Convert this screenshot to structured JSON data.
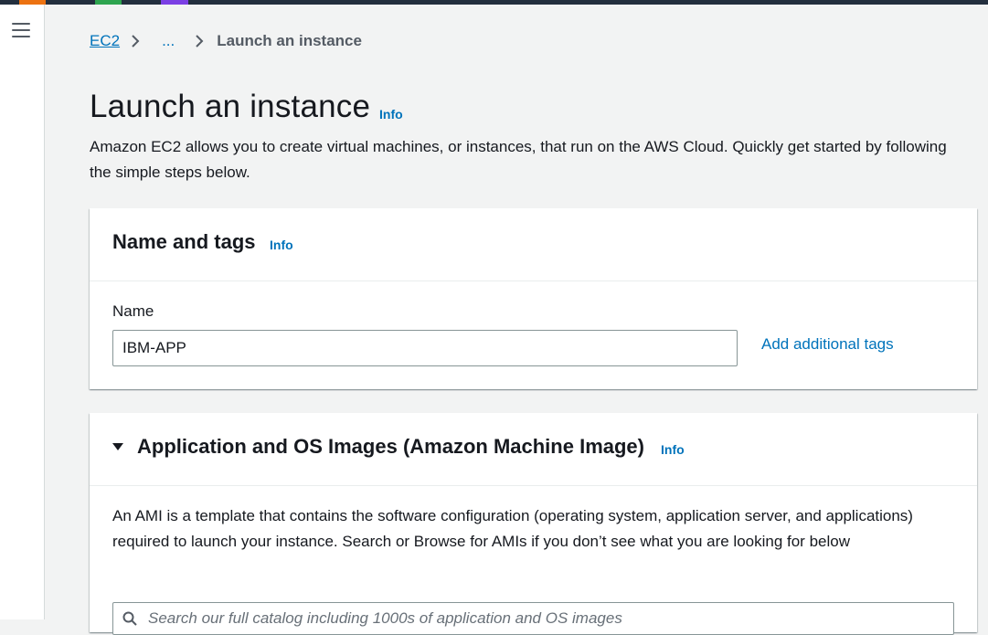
{
  "colors": {
    "topbar": "#232f3e",
    "link": "#0073bb",
    "page_bg": "#f2f3f3",
    "panel_bg": "#ffffff",
    "text": "#16191f"
  },
  "icons": {
    "menu": "hamburger-menu-icon",
    "breadcrumb_separator": "chevron-right-icon",
    "collapse": "caret-down-icon",
    "search": "search-icon"
  },
  "breadcrumb": {
    "root": "EC2",
    "ellipsis": "...",
    "current": "Launch an instance"
  },
  "page": {
    "title": "Launch an instance",
    "info": "Info",
    "description": "Amazon EC2 allows you to create virtual machines, or instances, that run on the AWS Cloud. Quickly get started by following the simple steps below."
  },
  "name_tags": {
    "title": "Name and tags",
    "info": "Info",
    "name_label": "Name",
    "name_value": "IBM-APP",
    "add_tags_label": "Add additional tags"
  },
  "ami": {
    "title": "Application and OS Images (Amazon Machine Image)",
    "info": "Info",
    "description": "An AMI is a template that contains the software configuration (operating system, application server, and applications) required to launch your instance. Search or Browse for AMIs if you don’t see what you are looking for below",
    "search_placeholder": "Search our full catalog including 1000s of application and OS images"
  }
}
